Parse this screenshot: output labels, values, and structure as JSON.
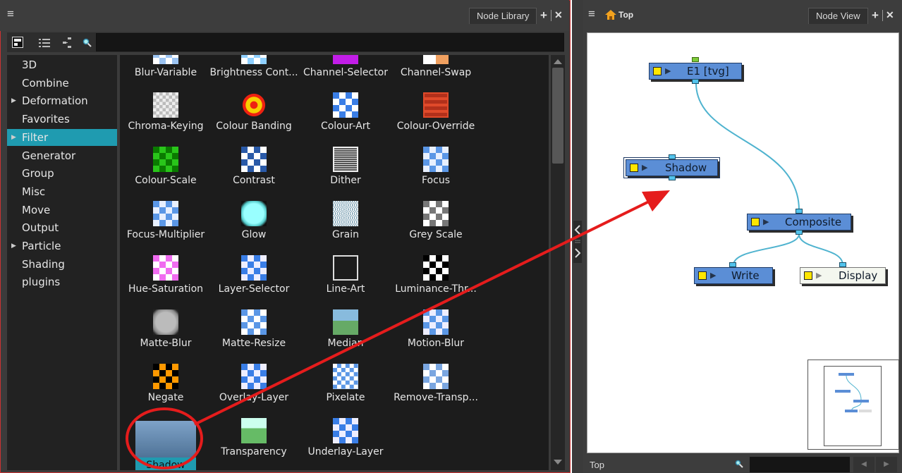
{
  "library": {
    "tab_label": "Node Library",
    "menu_icon": "≡",
    "add_icon": "+",
    "close_icon": "✕",
    "search_value": "",
    "categories": [
      {
        "label": "3D",
        "expandable": false,
        "selected": false
      },
      {
        "label": "Combine",
        "expandable": false,
        "selected": false
      },
      {
        "label": "Deformation",
        "expandable": true,
        "selected": false
      },
      {
        "label": "Favorites",
        "expandable": false,
        "selected": false
      },
      {
        "label": "Filter",
        "expandable": true,
        "selected": true
      },
      {
        "label": "Generator",
        "expandable": false,
        "selected": false
      },
      {
        "label": "Group",
        "expandable": false,
        "selected": false
      },
      {
        "label": "Misc",
        "expandable": false,
        "selected": false
      },
      {
        "label": "Move",
        "expandable": false,
        "selected": false
      },
      {
        "label": "Output",
        "expandable": false,
        "selected": false
      },
      {
        "label": "Particle",
        "expandable": true,
        "selected": false
      },
      {
        "label": "Shading",
        "expandable": false,
        "selected": false
      },
      {
        "label": "plugins",
        "expandable": false,
        "selected": false
      }
    ],
    "nodes": [
      {
        "label": "Blur-Variable"
      },
      {
        "label": "Brightness Cont..."
      },
      {
        "label": "Channel-Selector"
      },
      {
        "label": "Channel-Swap"
      },
      {
        "label": "Chroma-Keying"
      },
      {
        "label": "Colour Banding"
      },
      {
        "label": "Colour-Art"
      },
      {
        "label": "Colour-Override"
      },
      {
        "label": "Colour-Scale"
      },
      {
        "label": "Contrast"
      },
      {
        "label": "Dither"
      },
      {
        "label": "Focus"
      },
      {
        "label": "Focus-Multiplier"
      },
      {
        "label": "Glow"
      },
      {
        "label": "Grain"
      },
      {
        "label": "Grey Scale"
      },
      {
        "label": "Hue-Saturation"
      },
      {
        "label": "Layer-Selector"
      },
      {
        "label": "Line-Art"
      },
      {
        "label": "Luminance-Thr..."
      },
      {
        "label": "Matte-Blur"
      },
      {
        "label": "Matte-Resize"
      },
      {
        "label": "Median"
      },
      {
        "label": "Motion-Blur"
      },
      {
        "label": "Negate"
      },
      {
        "label": "Overlay-Layer"
      },
      {
        "label": "Pixelate"
      },
      {
        "label": "Remove-Transp..."
      },
      {
        "label": "Shadow",
        "selected": true
      },
      {
        "label": "Transparency"
      },
      {
        "label": "Underlay-Layer"
      }
    ]
  },
  "view": {
    "breadcrumb": "Top",
    "tab_label": "Node View",
    "menu_icon": "≡",
    "add_icon": "+",
    "close_icon": "✕",
    "status_label": "Top",
    "nodes": {
      "e1": "E1 [tvg]",
      "shadow": "Shadow",
      "composite": "Composite",
      "write": "Write",
      "display": "Display"
    }
  },
  "colors": {
    "selection": "#1f9bb0",
    "node_fill": "#5b8ed6",
    "cable": "#4fb3cf",
    "annotation": "#e51c1c"
  }
}
